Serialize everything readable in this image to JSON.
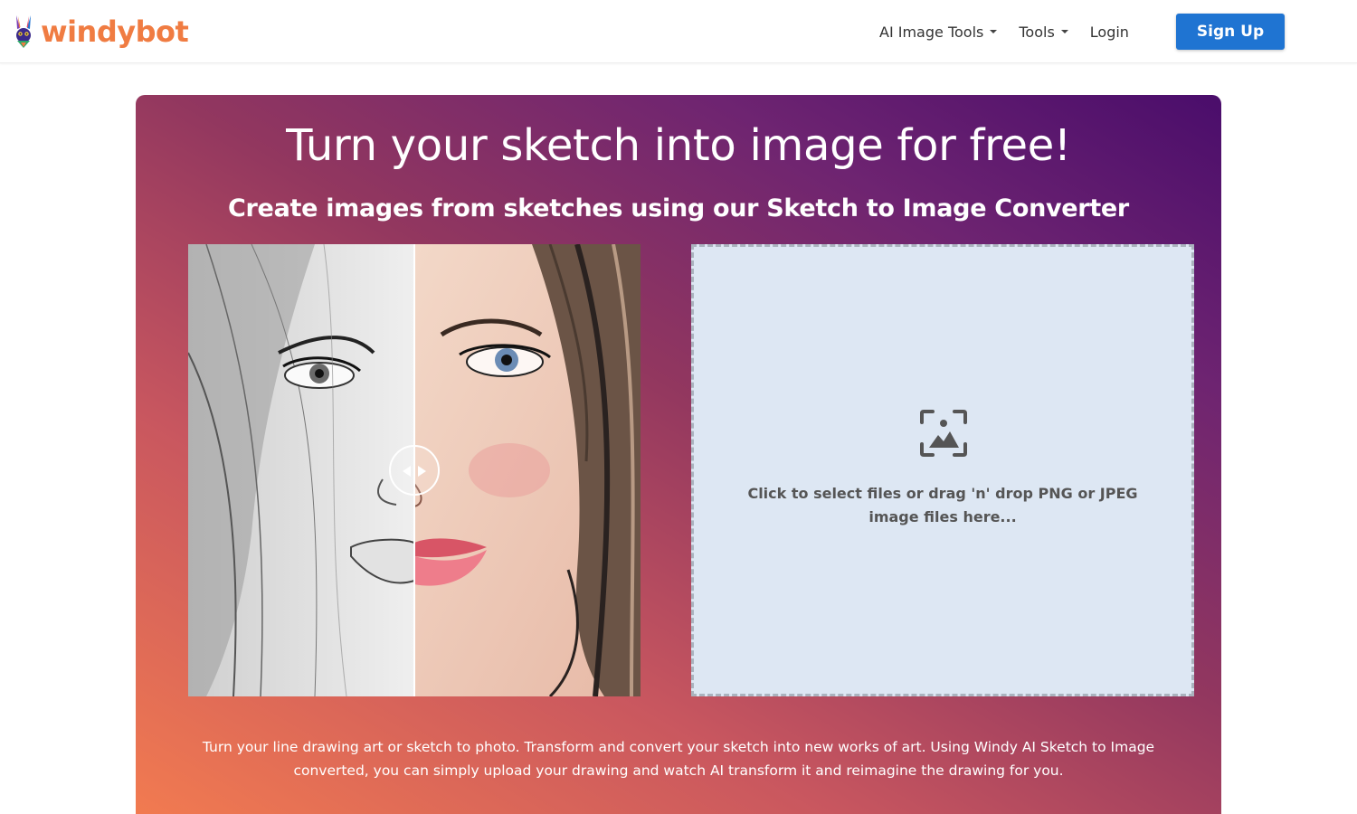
{
  "brand": {
    "name": "windybot",
    "color": "#f07c42"
  },
  "nav": {
    "items": [
      {
        "label": "AI Image Tools",
        "dropdown": true
      },
      {
        "label": "Tools",
        "dropdown": true
      },
      {
        "label": "Login",
        "dropdown": false
      }
    ],
    "signup_label": "Sign Up",
    "signup_color": "#1f74d2"
  },
  "hero": {
    "title": "Turn your sketch into image for free!",
    "subtitle": "Create images from sketches using our Sketch to Image Converter",
    "gradient_colors": [
      "#f27b50",
      "#c9575f",
      "#92375f",
      "#6e2471",
      "#4a0d6b"
    ],
    "compare": {
      "left_icon": "sketch-image",
      "right_icon": "photo-image",
      "handle_icon": "left-right-arrows-icon"
    },
    "dropzone": {
      "icon": "image-upload-icon",
      "text": "Click to select files or drag 'n' drop PNG or JPEG image files here...",
      "background": "#dde7f3"
    },
    "description": "Turn your line drawing art or sketch to photo. Transform and convert your sketch into new works of art. Using Windy AI Sketch to Image converted, you can simply upload your drawing and watch AI transform it and reimagine the drawing for you."
  }
}
